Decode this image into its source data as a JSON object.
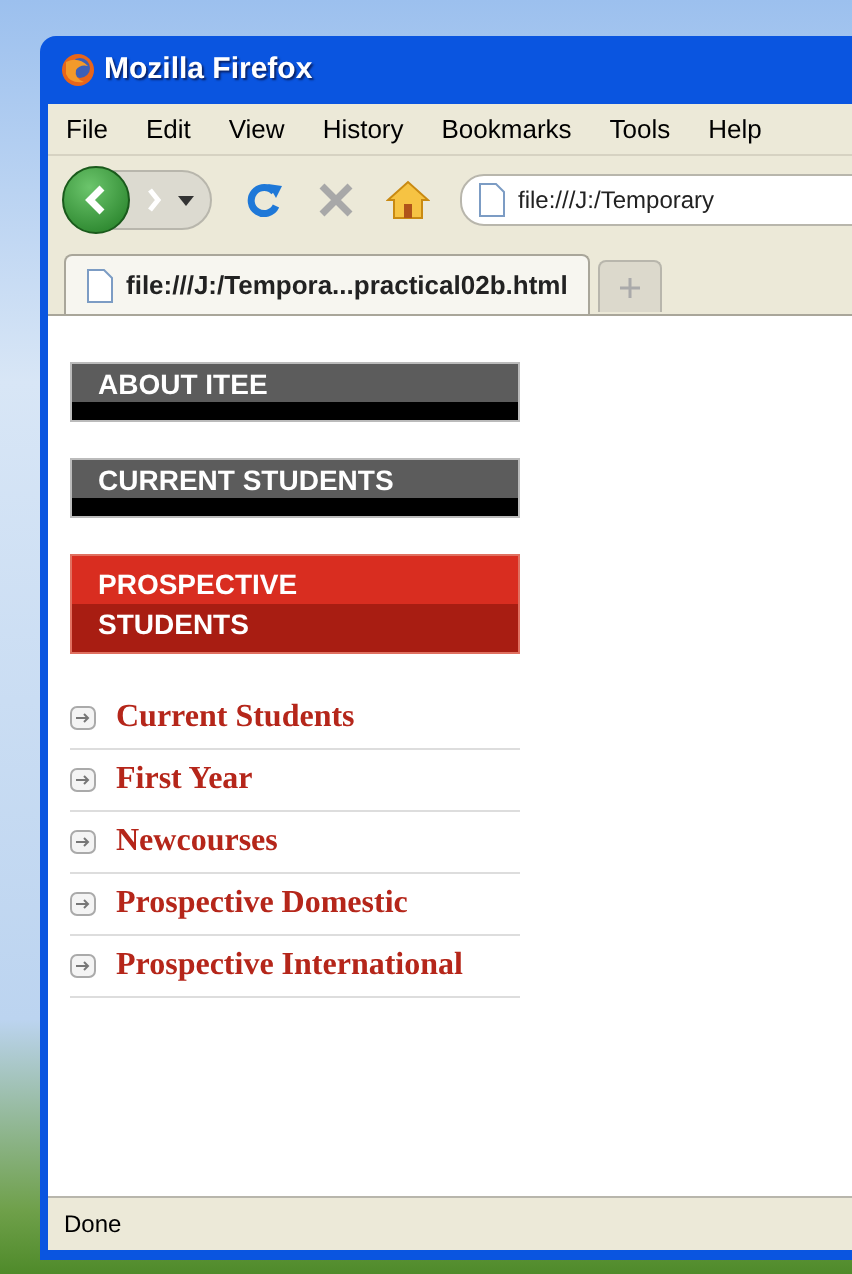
{
  "window": {
    "title": "Mozilla Firefox"
  },
  "menu_bar": [
    "File",
    "Edit",
    "View",
    "History",
    "Bookmarks",
    "Tools",
    "Help"
  ],
  "address_bar": {
    "value": "file:///J:/Temporary"
  },
  "tabs": [
    {
      "label": "file:///J:/Tempora...practical02b.html",
      "selected": true
    }
  ],
  "nav": [
    {
      "label": "ABOUT ITEE",
      "selected": false
    },
    {
      "label": "CURRENT STUDENTS",
      "selected": false
    },
    {
      "label": "PROSPECTIVE STUDENTS",
      "selected": true
    }
  ],
  "sub_links": [
    "Current Students",
    "First Year",
    "Newcourses",
    "Prospective Domestic",
    "Prospective International"
  ],
  "status_bar": "Done"
}
